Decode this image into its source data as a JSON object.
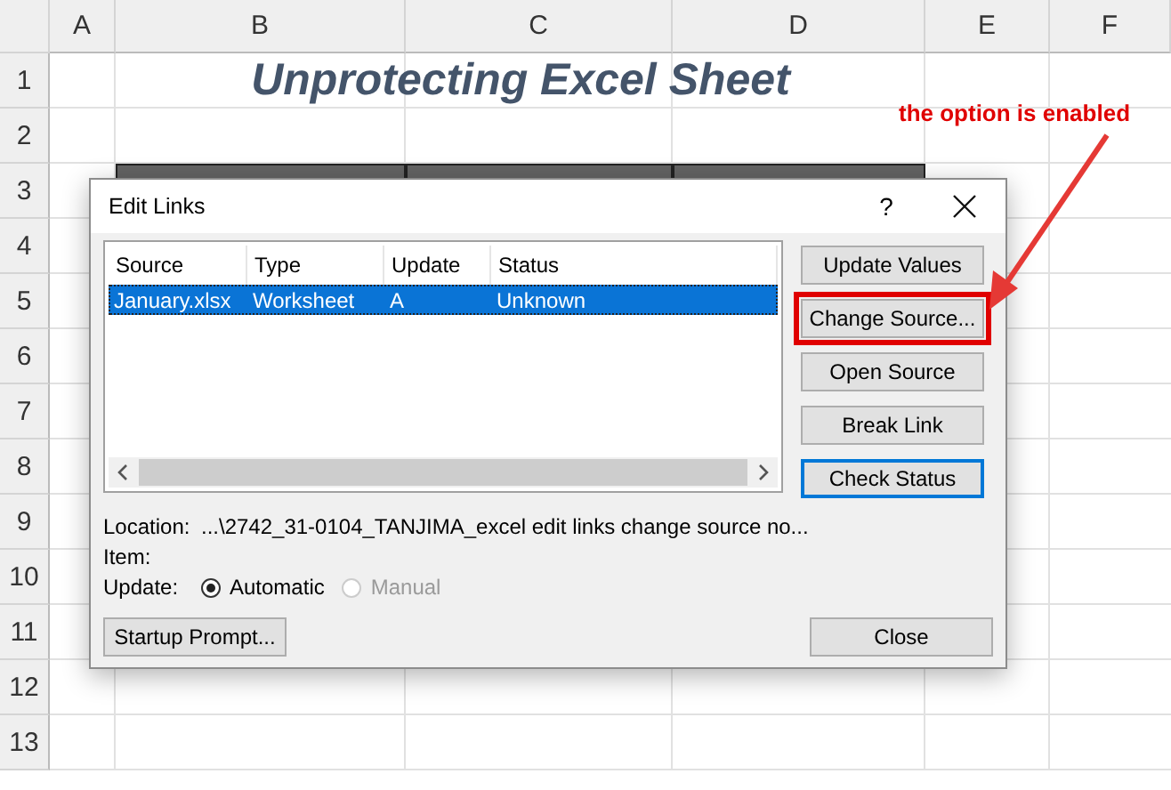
{
  "sheet": {
    "columns": [
      "A",
      "B",
      "C",
      "D",
      "E",
      "F"
    ],
    "rows": [
      "1",
      "2",
      "3",
      "4",
      "5",
      "6",
      "7",
      "8",
      "9",
      "10",
      "11",
      "12",
      "13"
    ],
    "title": "Unprotecting Excel Sheet"
  },
  "dialog": {
    "title": "Edit Links",
    "help": "?",
    "links": {
      "columns": [
        "Source",
        "Type",
        "Update",
        "Status"
      ],
      "rows": [
        {
          "cells": [
            "January.xlsx",
            "Worksheet",
            "A",
            "Unknown"
          ],
          "selected": true
        }
      ]
    },
    "buttons": [
      {
        "label": "Update Values",
        "highlighted": false,
        "default": false
      },
      {
        "label": "Change Source...",
        "highlighted": true,
        "default": false
      },
      {
        "label": "Open Source",
        "highlighted": false,
        "default": false
      },
      {
        "label": "Break Link",
        "highlighted": false,
        "default": false
      },
      {
        "label": "Check Status",
        "highlighted": false,
        "default": true
      }
    ],
    "location_label": "Location:",
    "location": "...\\2742_31-0104_TANJIMA_excel edit links change source no...",
    "item_label": "Item:",
    "update_label": "Update:",
    "update_options": [
      {
        "label": "Automatic",
        "selected": true,
        "disabled": false
      },
      {
        "label": "Manual",
        "selected": false,
        "disabled": true
      }
    ],
    "startup_button": "Startup Prompt...",
    "close_button": "Close"
  },
  "annotation": {
    "text": "the option is enabled"
  }
}
